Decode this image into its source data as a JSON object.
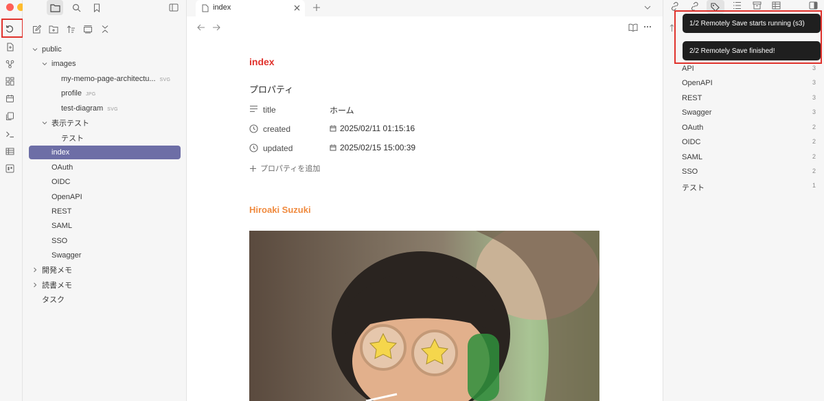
{
  "tabs": [
    {
      "label": "index"
    }
  ],
  "explorer": {
    "tree": [
      {
        "label": "public",
        "ext": ""
      },
      {
        "label": "images",
        "ext": ""
      },
      {
        "label": "my-memo-page-architectu...",
        "ext": "SVG"
      },
      {
        "label": "profile",
        "ext": "JPG"
      },
      {
        "label": "test-diagram",
        "ext": "SVG"
      },
      {
        "label": "表示テスト",
        "ext": ""
      },
      {
        "label": "テスト",
        "ext": ""
      },
      {
        "label": "index",
        "ext": ""
      },
      {
        "label": "OAuth",
        "ext": ""
      },
      {
        "label": "OIDC",
        "ext": ""
      },
      {
        "label": "OpenAPI",
        "ext": ""
      },
      {
        "label": "REST",
        "ext": ""
      },
      {
        "label": "SAML",
        "ext": ""
      },
      {
        "label": "SSO",
        "ext": ""
      },
      {
        "label": "Swagger",
        "ext": ""
      },
      {
        "label": "開発メモ",
        "ext": ""
      },
      {
        "label": "読書メモ",
        "ext": ""
      },
      {
        "label": "タスク",
        "ext": ""
      }
    ]
  },
  "note": {
    "title": "index",
    "properties_heading": "プロパティ",
    "properties": [
      {
        "name": "title",
        "value": "ホーム"
      },
      {
        "name": "created",
        "value": "2025/02/11 01:15:16"
      },
      {
        "name": "updated",
        "value": "2025/02/15 15:00:39"
      }
    ],
    "add_property": "プロパティを追加",
    "heading2": "Hiroaki Suzuki"
  },
  "tags": [
    {
      "name": "API",
      "count": "3"
    },
    {
      "name": "OpenAPI",
      "count": "3"
    },
    {
      "name": "REST",
      "count": "3"
    },
    {
      "name": "Swagger",
      "count": "3"
    },
    {
      "name": "OAuth",
      "count": "2"
    },
    {
      "name": "OIDC",
      "count": "2"
    },
    {
      "name": "SAML",
      "count": "2"
    },
    {
      "name": "SSO",
      "count": "2"
    },
    {
      "name": "テスト",
      "count": "1"
    }
  ],
  "notifications": [
    {
      "text": "1/2 Remotely Save starts running (s3)"
    },
    {
      "text": "2/2 Remotely Save finished!"
    }
  ],
  "colors": {
    "accent": "#6d6ea6",
    "title": "#e0312b",
    "heading2": "#f08a3e",
    "highlight_box": "#e0312b"
  }
}
